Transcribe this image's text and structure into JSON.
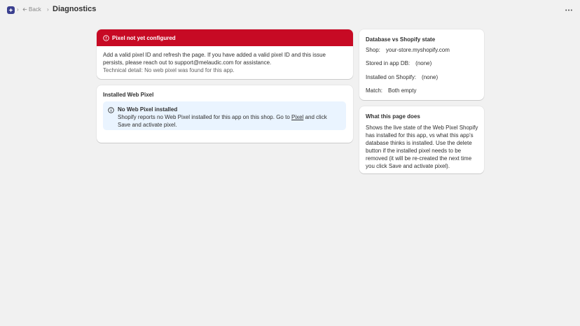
{
  "header": {
    "separator": "›",
    "back_label": "Back",
    "title": "Diagnostics"
  },
  "error_banner": {
    "title": "Pixel not yet configured",
    "body": "Add a valid pixel ID and refresh the page. If you have added a valid pixel ID and this issue persists, please reach out to support@melaudic.com for assistance.",
    "technical": "Technical detail: No web pixel was found for this app."
  },
  "installed_pixel": {
    "title": "Installed Web Pixel",
    "notice_title": "No Web Pixel installed",
    "notice_text_before": "Shopify reports no Web Pixel installed for this app on this shop. Go to",
    "notice_link": "Pixel",
    "notice_text_after": "and click Save and activate pixel."
  },
  "state_card": {
    "title": "Database vs Shopify state",
    "rows": [
      {
        "label": "Shop:",
        "value": "your-store.myshopify.com"
      },
      {
        "label": "Stored in app DB:",
        "value": "(none)"
      },
      {
        "label": "Installed on Shopify:",
        "value": "(none)"
      },
      {
        "label": "Match:",
        "value": "Both empty"
      }
    ]
  },
  "about_card": {
    "title": "What this page does",
    "text": "Shows the live state of the Web Pixel Shopify has installed for this app, vs what this app's database thinks is installed. Use the delete button if the installed pixel needs to be removed (it will be re-created the next time you click Save and activate pixel)."
  },
  "colors": {
    "critical": "#c70a24",
    "info_bg": "#eaf4ff",
    "app_icon": "#3a3f8f"
  }
}
